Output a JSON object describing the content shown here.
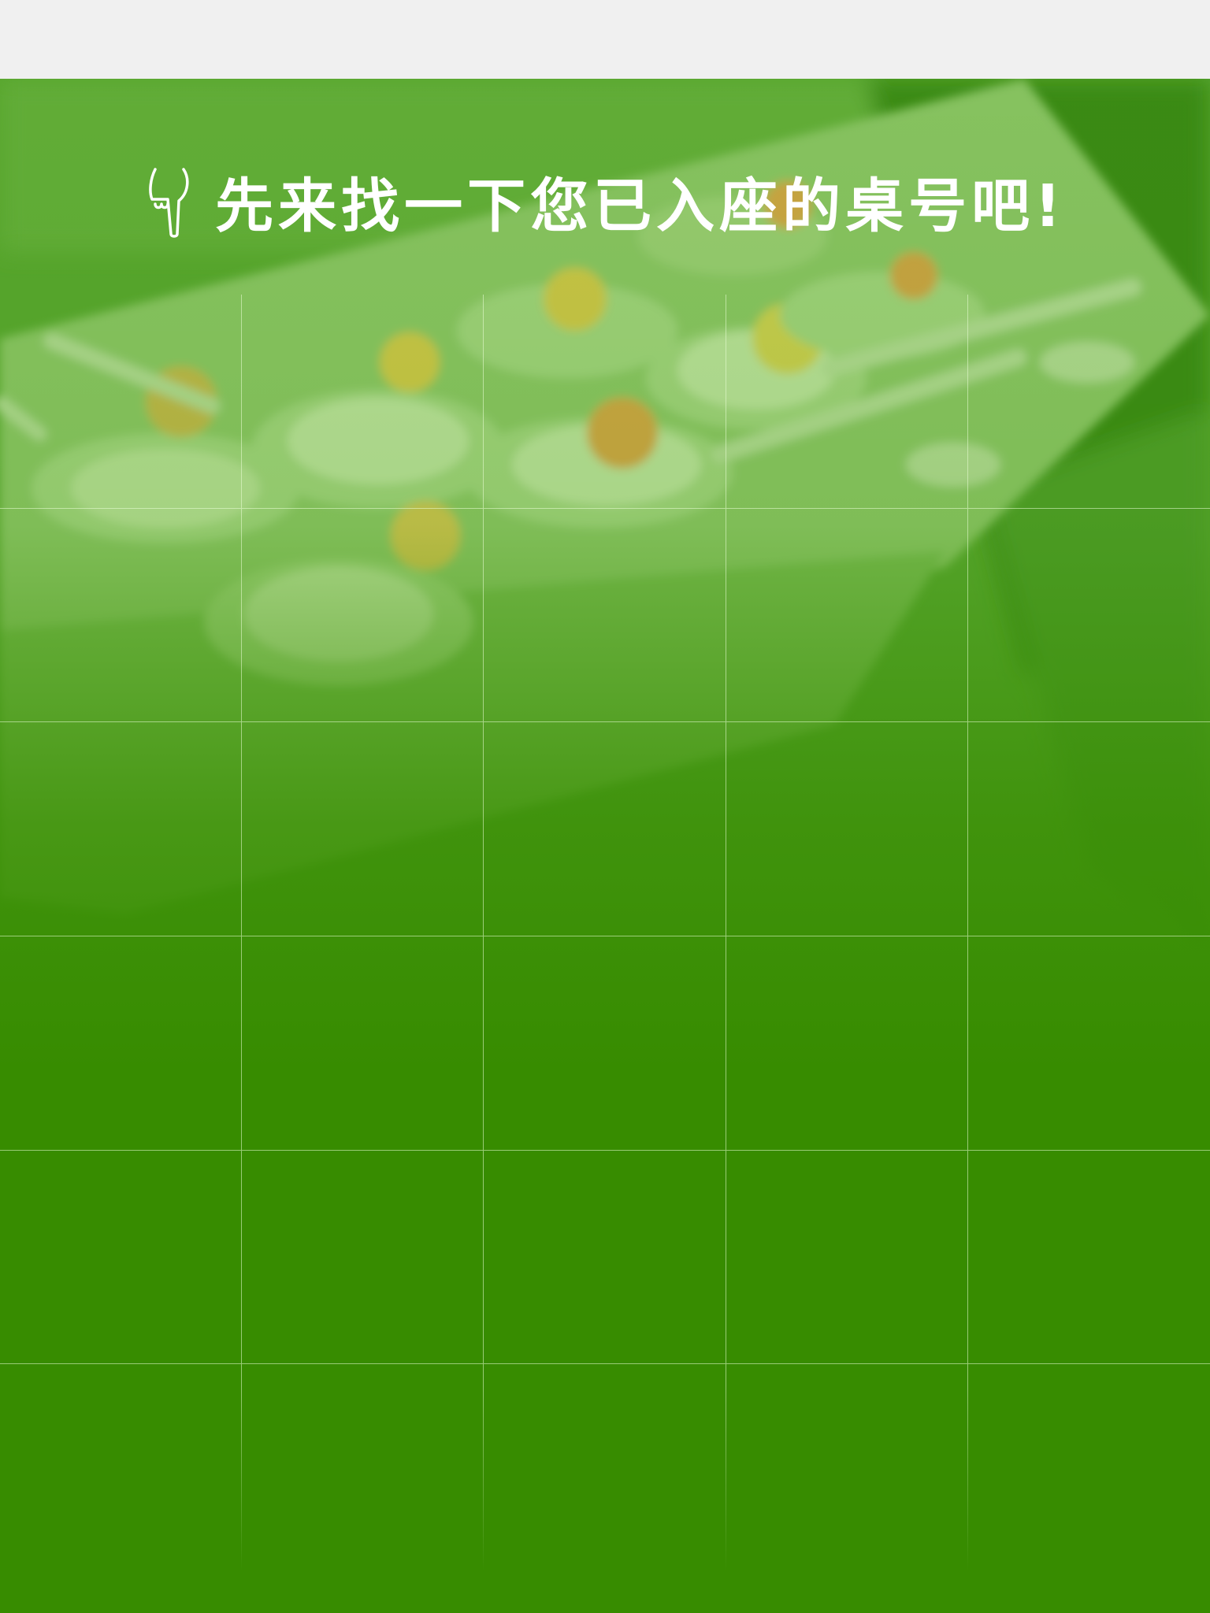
{
  "header": {
    "title": "先来找一下您已入座的桌号吧!",
    "hand_icon": "pointing-hand-icon"
  },
  "background": {
    "image": "blurred-appetizer-spoons-photo",
    "tint_color": "#378c00"
  },
  "table_grid": {
    "columns": 5,
    "rows": 6,
    "cells": [
      "",
      "",
      "",
      "",
      "",
      "",
      "",
      "",
      "",
      "",
      "",
      "",
      "",
      "",
      "",
      "",
      "",
      "",
      "",
      "",
      "",
      "",
      "",
      "",
      "",
      "",
      "",
      "",
      "",
      ""
    ]
  },
  "colors": {
    "top_bar": "#f0f0f0",
    "primary_green": "#378c00",
    "title_text": "#ffffff",
    "grid_line": "#ebffd7"
  }
}
